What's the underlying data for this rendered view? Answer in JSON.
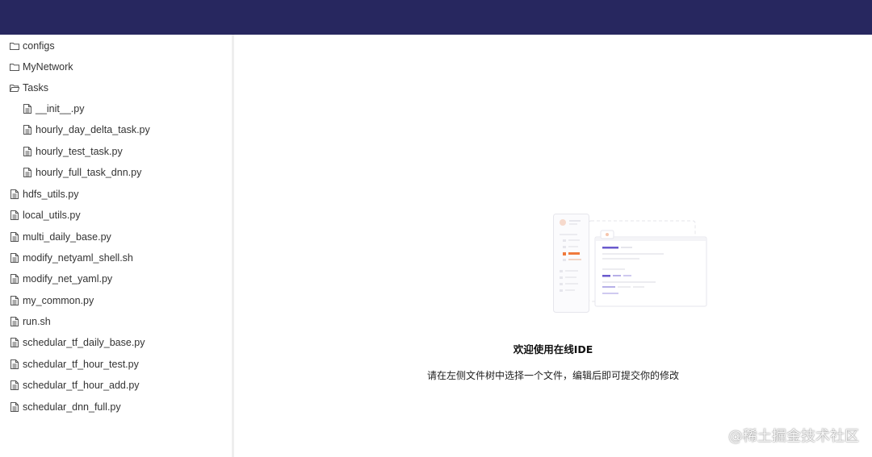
{
  "topbar": {
    "color": "#27275f"
  },
  "tree": {
    "items": [
      {
        "label": "configs",
        "icon": "folder-icon"
      },
      {
        "label": "MyNetwork",
        "icon": "folder-icon"
      },
      {
        "label": "Tasks",
        "icon": "folder-open-icon"
      },
      {
        "label": "__init__.py",
        "icon": "file-icon"
      },
      {
        "label": "hourly_day_delta_task.py",
        "icon": "file-icon"
      },
      {
        "label": "hourly_test_task.py",
        "icon": "file-icon"
      },
      {
        "label": "hourly_full_task_dnn.py",
        "icon": "file-icon"
      },
      {
        "label": "hdfs_utils.py",
        "icon": "file-icon"
      },
      {
        "label": "local_utils.py",
        "icon": "file-icon"
      },
      {
        "label": "multi_daily_base.py",
        "icon": "file-icon"
      },
      {
        "label": "modify_netyaml_shell.sh",
        "icon": "file-icon"
      },
      {
        "label": "modify_net_yaml.py",
        "icon": "file-icon"
      },
      {
        "label": "my_common.py",
        "icon": "file-icon"
      },
      {
        "label": "run.sh",
        "icon": "file-icon"
      },
      {
        "label": "schedular_tf_daily_base.py",
        "icon": "file-icon"
      },
      {
        "label": "schedular_tf_hour_test.py",
        "icon": "file-icon"
      },
      {
        "label": "schedular_tf_hour_add.py",
        "icon": "file-icon"
      },
      {
        "label": "schedular_dnn_full.py",
        "icon": "file-icon"
      }
    ]
  },
  "main": {
    "welcome_title": "欢迎使用在线IDE",
    "welcome_desc": "请在左侧文件树中选择一个文件，编辑后即可提交你的修改",
    "accent_colors": {
      "purple": "#6a5acd",
      "orange": "#f07a3c"
    }
  },
  "watermark": "@稀土掘金技术社区"
}
